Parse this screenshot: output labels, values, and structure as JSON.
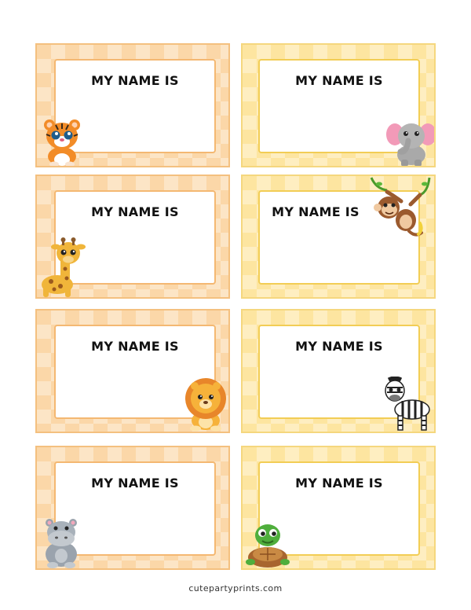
{
  "tags": [
    {
      "label": "MY NAME IS",
      "animal": "tiger-icon",
      "theme": "orange"
    },
    {
      "label": "MY NAME IS",
      "animal": "elephant-icon",
      "theme": "yellow"
    },
    {
      "label": "MY NAME IS",
      "animal": "giraffe-icon",
      "theme": "orange"
    },
    {
      "label": "MY NAME IS",
      "animal": "monkey-icon",
      "theme": "yellow"
    },
    {
      "label": "MY NAME IS",
      "animal": "lion-icon",
      "theme": "orange"
    },
    {
      "label": "MY NAME IS",
      "animal": "zebra-icon",
      "theme": "yellow"
    },
    {
      "label": "MY NAME IS",
      "animal": "hippo-icon",
      "theme": "orange"
    },
    {
      "label": "MY NAME IS",
      "animal": "turtle-icon",
      "theme": "yellow"
    }
  ],
  "footer": "cutepartyprints.com",
  "colors": {
    "orange_frame": "#fbd7a8",
    "yellow_frame": "#fde5a0",
    "orange_border": "#f4b872",
    "yellow_border": "#f2cd55"
  }
}
